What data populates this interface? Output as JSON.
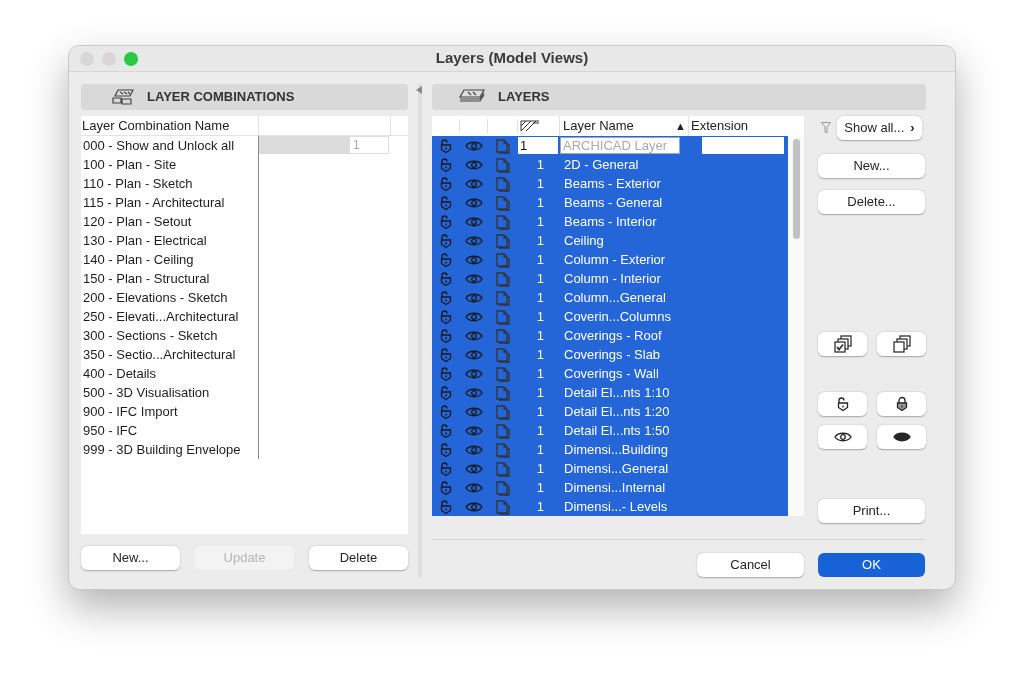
{
  "window": {
    "title": "Layers (Model Views)",
    "controls": [
      {
        "color": "#d9d6d6"
      },
      {
        "color": "#d9d6d6"
      },
      {
        "color": "#29c940"
      }
    ]
  },
  "combinations": {
    "title": "LAYER COMBINATIONS",
    "column": "Layer Combination Name",
    "items": [
      {
        "name": "000 - Show and Unlock all",
        "value": "1"
      },
      {
        "name": "100 - Plan - Site"
      },
      {
        "name": "110 - Plan - Sketch"
      },
      {
        "name": "115 - Plan - Architectural"
      },
      {
        "name": "120 - Plan - Setout"
      },
      {
        "name": "130 - Plan - Electrical"
      },
      {
        "name": "140 - Plan - Ceiling"
      },
      {
        "name": "150 - Plan - Structural"
      },
      {
        "name": "200 - Elevations - Sketch"
      },
      {
        "name": "250 - Elevati...Architectural"
      },
      {
        "name": "300 - Sections - Sketch"
      },
      {
        "name": "350 - Sectio...Architectural"
      },
      {
        "name": "400 - Details"
      },
      {
        "name": "500 - 3D Visualisation"
      },
      {
        "name": "900 - IFC Import"
      },
      {
        "name": "950 - IFC"
      },
      {
        "name": "999 - 3D Building Envelope"
      }
    ],
    "buttons": [
      {
        "label": "New...",
        "disabled": false
      },
      {
        "label": "Update",
        "disabled": true
      },
      {
        "label": "Delete",
        "disabled": false
      }
    ]
  },
  "layers": {
    "title": "LAYERS",
    "columns": [
      {
        "label": "Layer Name",
        "sort_mark": "▲"
      },
      {
        "label": "Extension"
      }
    ],
    "rows": [
      {
        "kind": "edit",
        "pen": "1",
        "placeholder": "ARCHICAD Layer",
        "selected": true
      },
      {
        "kind": "plain",
        "pen": "1",
        "name": "2D - General",
        "selected": true
      },
      {
        "kind": "plain",
        "pen": "1",
        "name": "Beams - Exterior",
        "selected": true
      },
      {
        "kind": "plain",
        "pen": "1",
        "name": "Beams - General",
        "selected": true
      },
      {
        "kind": "plain",
        "pen": "1",
        "name": "Beams - Interior",
        "selected": true
      },
      {
        "kind": "plain",
        "pen": "1",
        "name": "Ceiling",
        "selected": true
      },
      {
        "kind": "plain",
        "pen": "1",
        "name": "Column - Exterior",
        "selected": true
      },
      {
        "kind": "plain",
        "pen": "1",
        "name": "Column - Interior",
        "selected": true
      },
      {
        "kind": "plain",
        "pen": "1",
        "name": "Column...General",
        "selected": true
      },
      {
        "kind": "plain",
        "pen": "1",
        "name": "Coverin...Columns",
        "selected": true
      },
      {
        "kind": "plain",
        "pen": "1",
        "name": "Coverings - Roof",
        "selected": true
      },
      {
        "kind": "plain",
        "pen": "1",
        "name": "Coverings - Slab",
        "selected": true
      },
      {
        "kind": "plain",
        "pen": "1",
        "name": "Coverings - Wall",
        "selected": true
      },
      {
        "kind": "plain",
        "pen": "1",
        "name": "Detail El...nts 1:10",
        "selected": true
      },
      {
        "kind": "plain",
        "pen": "1",
        "name": "Detail El...nts 1:20",
        "selected": true
      },
      {
        "kind": "plain",
        "pen": "1",
        "name": "Detail El...nts 1:50",
        "selected": true
      },
      {
        "kind": "plain",
        "pen": "1",
        "name": "Dimensi...Building",
        "selected": true
      },
      {
        "kind": "plain",
        "pen": "1",
        "name": "Dimensi...General",
        "selected": true
      },
      {
        "kind": "plain",
        "pen": "1",
        "name": "Dimensi...Internal",
        "selected": true
      },
      {
        "kind": "plain",
        "pen": "1",
        "name": "Dimensi...- Levels",
        "selected": true
      }
    ],
    "filter": "Show all...",
    "chevron": "›",
    "new_button": "New...",
    "delete_button": "Delete...",
    "print_button": "Print..."
  },
  "footer": {
    "buttons": [
      {
        "label": "Cancel",
        "kind": "normal"
      },
      {
        "label": "OK",
        "kind": "default"
      }
    ]
  }
}
